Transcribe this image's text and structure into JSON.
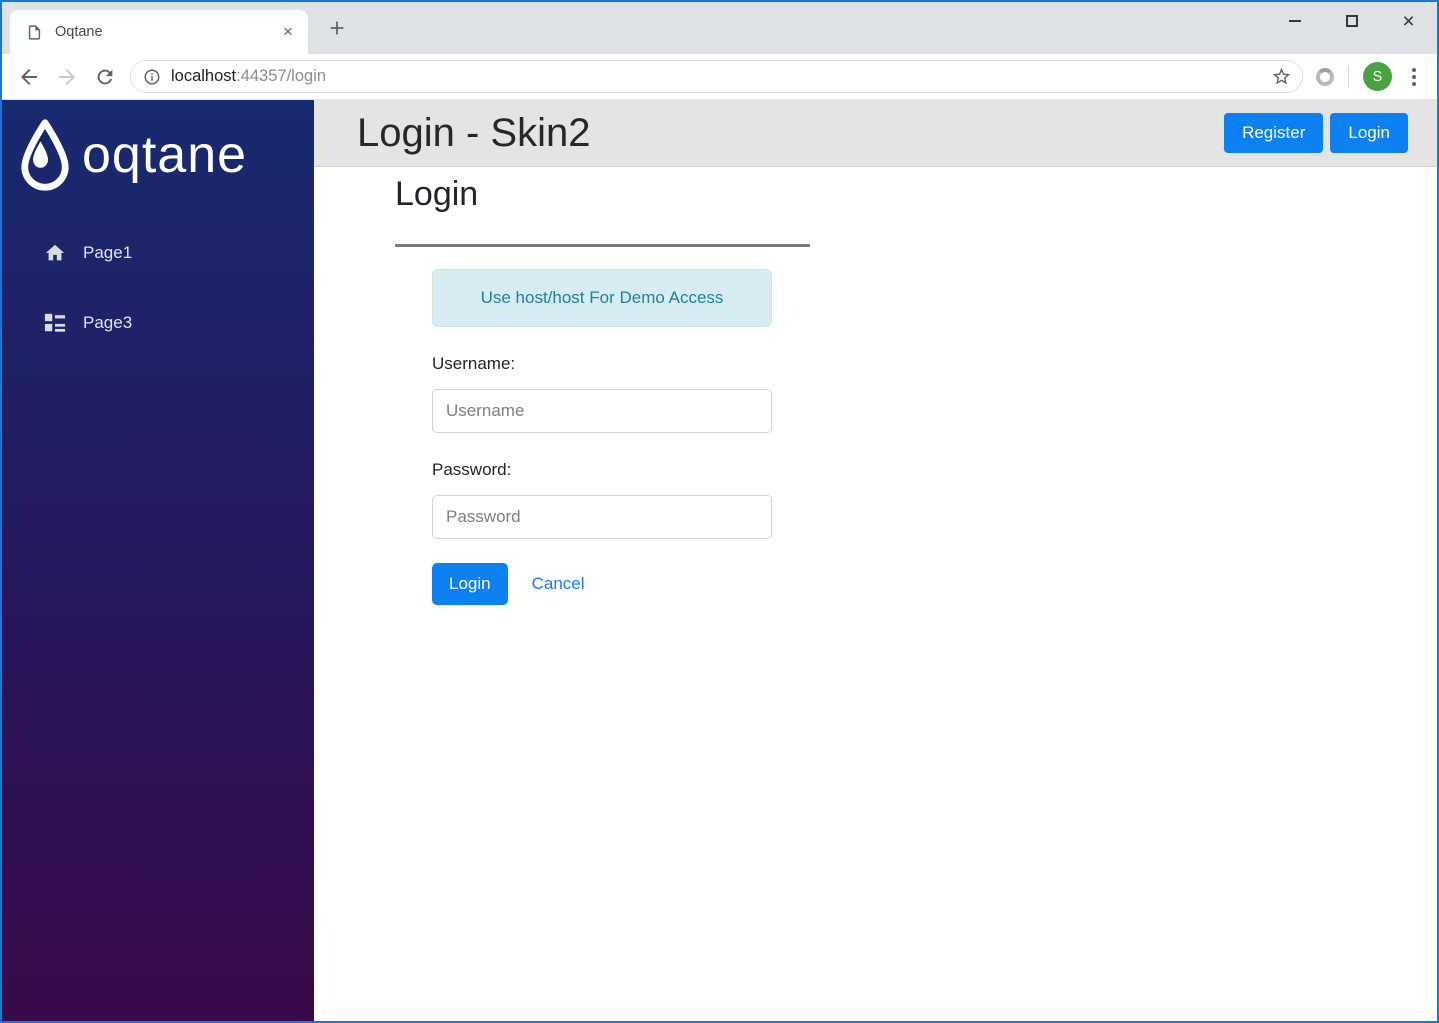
{
  "browser": {
    "tab_title": "Oqtane",
    "url_host": "localhost",
    "url_path": ":44357/login",
    "avatar_letter": "S"
  },
  "sidebar": {
    "logo_text": "oqtane",
    "items": [
      {
        "label": "Page1",
        "icon": "home-icon"
      },
      {
        "label": "Page3",
        "icon": "list-icon"
      }
    ]
  },
  "header": {
    "title": "Login - Skin2",
    "register_label": "Register",
    "login_label": "Login"
  },
  "login": {
    "heading": "Login",
    "alert_text": "Use host/host For Demo Access",
    "username_label": "Username:",
    "username_placeholder": "Username",
    "password_label": "Password:",
    "password_placeholder": "Password",
    "login_button": "Login",
    "cancel_label": "Cancel"
  },
  "colors": {
    "accent_blue": "#0d80f2",
    "window_border": "#1478dc",
    "sidebar_gradient_top": "#182a70",
    "sidebar_gradient_bottom": "#380a48",
    "header_strip": "#e4e4e4",
    "alert_bg": "#d8edf3",
    "alert_text": "#1f7f9e",
    "avatar_green": "#47a23f"
  }
}
